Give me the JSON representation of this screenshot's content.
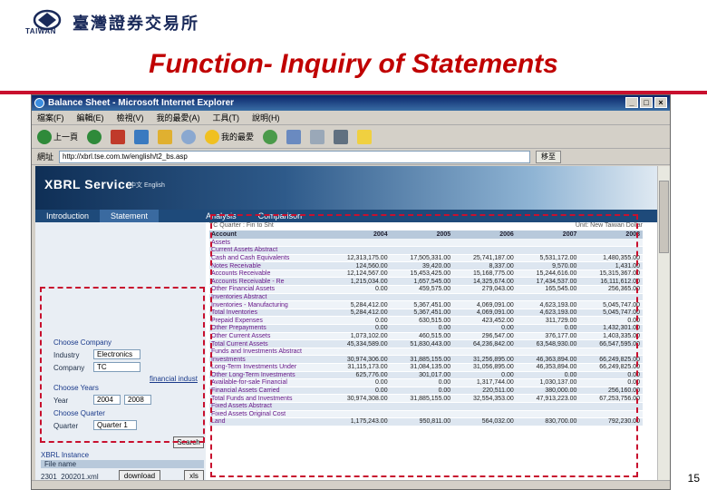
{
  "slide": {
    "logo_brand": "TAIWAN",
    "logo_cn": "臺灣證券交易所",
    "title": "Function- Inquiry of Statements",
    "page_number": "15"
  },
  "browser": {
    "window_title": "Balance Sheet - Microsoft Internet Explorer",
    "menu": [
      "檔案(F)",
      "編輯(E)",
      "檢視(V)",
      "我的最愛(A)",
      "工具(T)",
      "說明(H)"
    ],
    "toolbar": {
      "back": "上一頁",
      "favorites": "我的最愛"
    },
    "address_label": "網址",
    "url": "http://xbrl.tse.com.tw/english/t2_bs.asp",
    "go_label": "移至"
  },
  "site": {
    "brand": "XBRL Service",
    "lang": "中文  English",
    "nav": [
      "Introduction",
      "Statement",
      "Analysis",
      "Comparison"
    ]
  },
  "left_panel": {
    "choose_company": "Choose Company",
    "industry_label": "Industry",
    "industry_value": "Electronics",
    "company_label": "Company",
    "company_value": "TC",
    "financial_link": "financial indust",
    "choose_years": "Choose Years",
    "year_label": "Year",
    "year_from": "2004",
    "year_to": "2008",
    "choose_quarter": "Choose Quarter",
    "quarter_label": "Quarter",
    "quarter_value": "Quarter 1",
    "search_btn": "Search",
    "xbrl_instance": "XBRL Instance",
    "file_name_hdr": "File name",
    "file_name": "2301_200201.xml",
    "download_btn": "download",
    "xls_btn": "xls"
  },
  "grid": {
    "top_left": "TC Quarter : Fin  to Sht",
    "top_right": "Unit: New Taiwan Dollar",
    "headers": [
      "Account",
      "2004",
      "2005",
      "2006",
      "2007",
      "2008"
    ],
    "rows": [
      [
        "Assets",
        "",
        "",
        "",
        "",
        ""
      ],
      [
        "Current Assets Abstract",
        "",
        "",
        "",
        "",
        ""
      ],
      [
        "Cash and Cash Equivalents",
        "12,313,175.00",
        "17,505,331.00",
        "25,741,187.00",
        "5,531,172.00",
        "1,480,355.00"
      ],
      [
        "Notes Receivable",
        "124,560.00",
        "39,420.00",
        "8,337.00",
        "9,570.00",
        "1,431.00"
      ],
      [
        "Accounts Receivable",
        "12,124,567.00",
        "15,453,425.00",
        "15,168,775.00",
        "15,244,616.00",
        "15,315,367.00"
      ],
      [
        "Accounts Receivable - Re",
        "1,215,034.00",
        "1,657,545.00",
        "14,325,674.00",
        "17,434,537.00",
        "16,111,612.00"
      ],
      [
        "Other Financial Assets",
        "0.00",
        "459,575.00",
        "279,043.00",
        "165,545.00",
        "256,365.00"
      ],
      [
        "Inventories Abstract",
        "",
        "",
        "",
        "",
        ""
      ],
      [
        "Inventories - Manufacturing",
        "5,284,412.00",
        "5,367,451.00",
        "4,069,091.00",
        "4,623,193.00",
        "5,045,747.00"
      ],
      [
        "Total Inventories",
        "5,284,412.00",
        "5,367,451.00",
        "4,069,091.00",
        "4,623,193.00",
        "5,045,747.00"
      ],
      [
        "Prepaid Expenses",
        "0.00",
        "630,515.00",
        "423,452.00",
        "311,729.00",
        "0.00"
      ],
      [
        "Other Prepayments",
        "0.00",
        "0.00",
        "0.00",
        "0.00",
        "1,432,301.00"
      ],
      [
        "Other Current Assets",
        "1,073,102.00",
        "460,515.00",
        "296,547.00",
        "376,177.00",
        "1,403,335.00"
      ],
      [
        "Total Current Assets",
        "45,334,589.00",
        "51,830,443.00",
        "64,236,842.00",
        "63,548,930.00",
        "66,547,595.00"
      ],
      [
        "Funds and Investments Abstract",
        "",
        "",
        "",
        "",
        ""
      ],
      [
        "Investments",
        "30,974,306.00",
        "31,885,155.00",
        "31,256,895.00",
        "46,363,894.00",
        "66,249,825.00"
      ],
      [
        "Long-Term Investments Under",
        "31,115,173.00",
        "31,084,135.00",
        "31,056,895.00",
        "46,353,894.00",
        "66,249,825.00"
      ],
      [
        "Other Long-Term Investments",
        "625,776.00",
        "301,017.00",
        "0.00",
        "0.00",
        "0.00"
      ],
      [
        "Available-for-sale Financial",
        "0.00",
        "0.00",
        "1,317,744.00",
        "1,030,137.00",
        "0.00"
      ],
      [
        "Financial Assets Carried",
        "0.00",
        "0.00",
        "220,511.00",
        "380,000.00",
        "256,160.00"
      ],
      [
        "Total Funds and Investments",
        "30,974,308.00",
        "31,885,155.00",
        "32,554,353.00",
        "47,913,223.00",
        "67,253,756.00"
      ],
      [
        "Fixed Assets Abstract",
        "",
        "",
        "",
        "",
        ""
      ],
      [
        "Fixed Assets Original Cost",
        "",
        "",
        "",
        "",
        ""
      ],
      [
        "Land",
        "1,175,243.00",
        "950,811.00",
        "564,032.00",
        "830,700.00",
        "792,230.00"
      ]
    ]
  },
  "colors": {
    "title_red": "#c00000",
    "dashed_box": "#c8102e",
    "banner_dark": "#0f2f56"
  }
}
